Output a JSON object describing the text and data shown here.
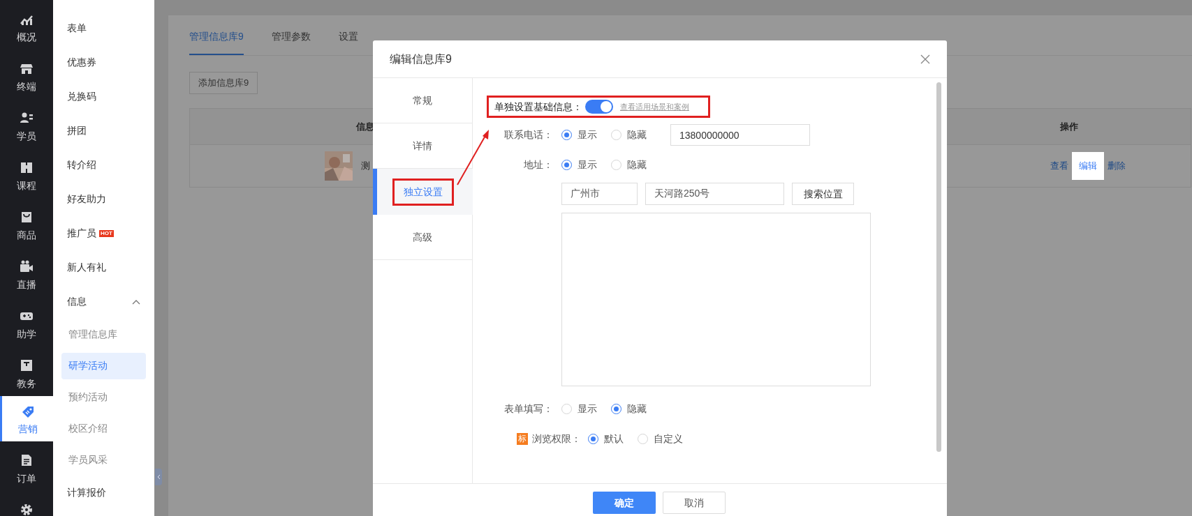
{
  "sidebar": {
    "items": [
      {
        "label": "概况",
        "selected": false
      },
      {
        "label": "终端",
        "selected": false
      },
      {
        "label": "学员",
        "selected": false
      },
      {
        "label": "课程",
        "selected": false
      },
      {
        "label": "商品",
        "selected": false
      },
      {
        "label": "直播",
        "selected": false
      },
      {
        "label": "助学",
        "selected": false
      },
      {
        "label": "教务",
        "selected": false
      },
      {
        "label": "营销",
        "selected": true
      },
      {
        "label": "订单",
        "selected": false
      },
      {
        "selected": false
      }
    ]
  },
  "menu": {
    "items": [
      {
        "label": "表单"
      },
      {
        "label": "优惠券"
      },
      {
        "label": "兑换码"
      },
      {
        "label": "拼团"
      },
      {
        "label": "转介绍"
      },
      {
        "label": "好友助力"
      },
      {
        "label": "推广员",
        "badge": "HOT"
      },
      {
        "label": "新人有礼"
      },
      {
        "label": "信息",
        "expanded": true,
        "children": [
          {
            "label": "管理信息库",
            "selected": false
          },
          {
            "label": "研学活动",
            "selected": true
          },
          {
            "label": "预约活动",
            "selected": false
          },
          {
            "label": "校区介绍",
            "selected": false
          },
          {
            "label": "学员风采",
            "selected": false
          }
        ]
      },
      {
        "label": "计算报价"
      }
    ]
  },
  "page": {
    "tabs": [
      {
        "label": "管理信息库9",
        "selected": true
      },
      {
        "label": "管理参数",
        "selected": false
      },
      {
        "label": "设置",
        "selected": false
      }
    ],
    "add_button": "添加信息库9",
    "table": {
      "columns": [
        "信息",
        "操作"
      ],
      "rows": [
        {
          "name": "测",
          "actions": [
            {
              "label": "查看",
              "highlighted": false
            },
            {
              "label": "编辑",
              "highlighted": true
            },
            {
              "label": "删除",
              "highlighted": false
            }
          ]
        }
      ]
    }
  },
  "dialog": {
    "title": "编辑信息库9",
    "tabs": [
      {
        "label": "常规",
        "selected": false,
        "annotated": false
      },
      {
        "label": "详情",
        "selected": false,
        "annotated": false
      },
      {
        "label": "独立设置",
        "selected": true,
        "annotated": true
      },
      {
        "label": "高级",
        "selected": false,
        "annotated": false
      }
    ],
    "switch_row": {
      "label": "单独设置基础信息：",
      "on": true,
      "link": "查看适用场景和案例",
      "annotated": true
    },
    "fields": [
      {
        "kind": "phone",
        "label": "联系电话：",
        "options": [
          {
            "label": "显示",
            "selected": true
          },
          {
            "label": "隐藏",
            "selected": false
          }
        ],
        "value": "13800000000"
      },
      {
        "kind": "address",
        "label": "地址：",
        "options": [
          {
            "label": "显示",
            "selected": true
          },
          {
            "label": "隐藏",
            "selected": false
          }
        ],
        "city": "广州市",
        "street": "天河路250号",
        "button": "搜索位置"
      },
      {
        "kind": "radio",
        "label": "表单填写：",
        "options": [
          {
            "label": "显示",
            "selected": false
          },
          {
            "label": "隐藏",
            "selected": true
          }
        ]
      },
      {
        "kind": "radio",
        "label": "浏览权限：",
        "tag": "标",
        "options": [
          {
            "label": "默认",
            "selected": true
          },
          {
            "label": "自定义",
            "selected": false
          }
        ]
      }
    ],
    "buttons": [
      {
        "label": "确定",
        "primary": true
      },
      {
        "label": "取消",
        "primary": false
      }
    ]
  }
}
